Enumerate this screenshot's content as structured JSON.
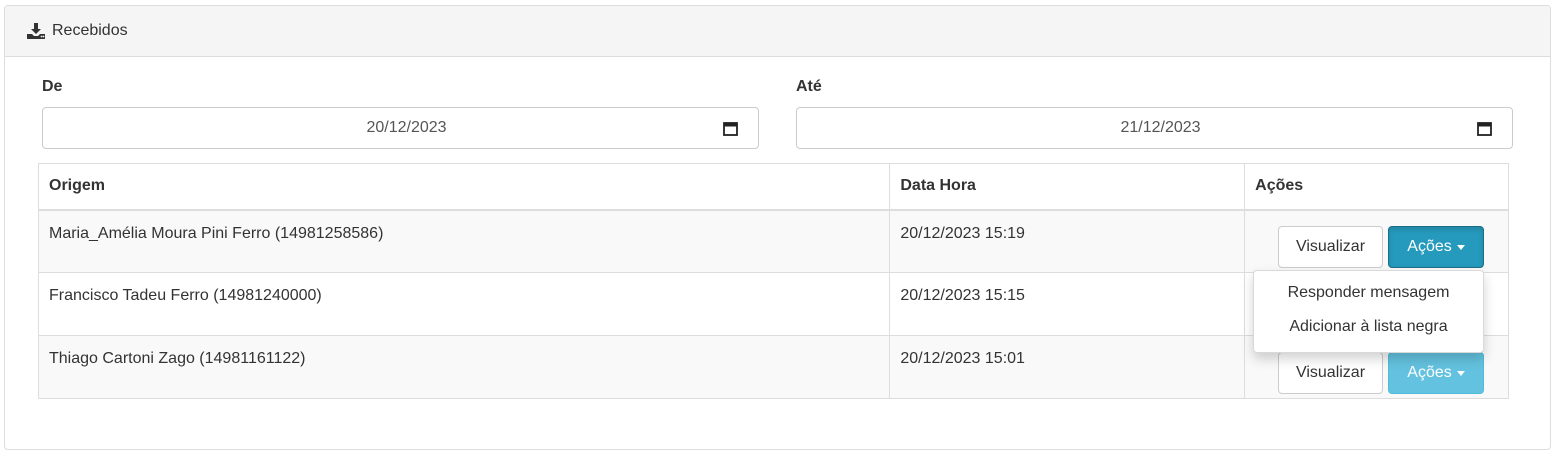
{
  "panel": {
    "title": "Recebidos",
    "icon": "download-icon"
  },
  "filters": {
    "from_label": "De",
    "from_value": "20/12/2023",
    "to_label": "Até",
    "to_value": "21/12/2023",
    "calendar_icon": "calendar-icon"
  },
  "table": {
    "headers": [
      "Origem",
      "Data Hora",
      "Ações"
    ],
    "rows": [
      {
        "origem": "Maria_Amélia Moura Pini Ferro (14981258586)",
        "data_hora": "20/12/2023 15:19"
      },
      {
        "origem": "Francisco Tadeu Ferro (14981240000)",
        "data_hora": "20/12/2023 15:15"
      },
      {
        "origem": "Thiago Cartoni Zago (14981161122)",
        "data_hora": "20/12/2023 15:01"
      }
    ],
    "view_label": "Visualizar",
    "actions_label": "Ações"
  },
  "dropdown": {
    "items": [
      "Responder mensagem",
      "Adicionar à lista negra"
    ]
  },
  "colors": {
    "info": "#31b0d5",
    "info_active": "#269abc",
    "border": "#dddddd",
    "heading_bg": "#f5f5f5"
  }
}
